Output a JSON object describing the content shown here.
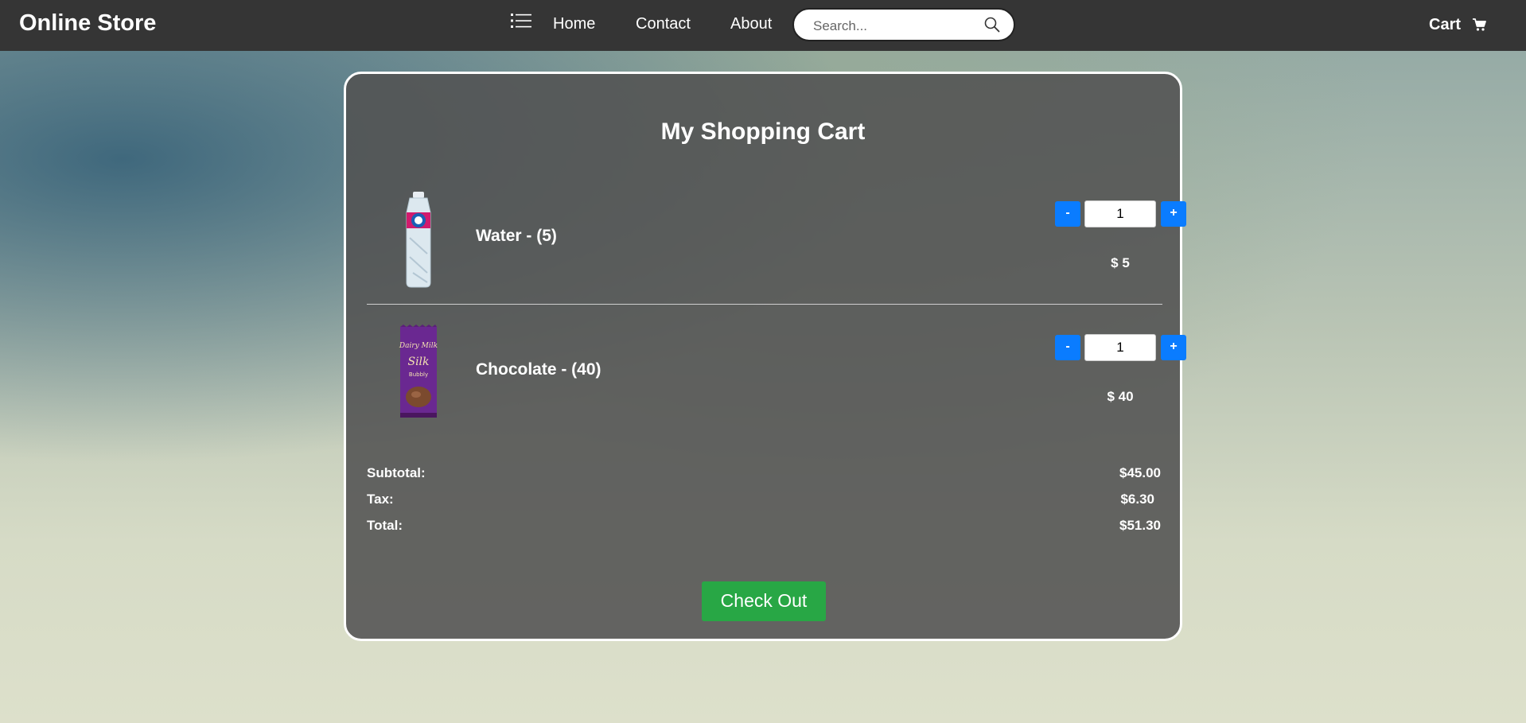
{
  "navbar": {
    "brand": "Online Store",
    "links": [
      "Home",
      "Contact",
      "About"
    ],
    "search_placeholder": "Search...",
    "cart_label": "Cart"
  },
  "cart": {
    "title": "My Shopping Cart",
    "items": [
      {
        "name": "Water - (5)",
        "quantity": "1",
        "price": "$ 5",
        "decrement": "-",
        "increment": "+"
      },
      {
        "name": "Chocolate - (40)",
        "quantity": "1",
        "price": "$ 40",
        "decrement": "-",
        "increment": "+"
      }
    ],
    "summary": {
      "subtotal_label": "Subtotal:",
      "subtotal": "$45.00",
      "tax_label": "Tax:",
      "tax": "$6.30",
      "total_label": "Total:",
      "total": "$51.30"
    },
    "checkout_label": "Check Out"
  },
  "colors": {
    "navbar": "#353535",
    "qty_button": "#0a7cff",
    "checkout": "#28a745"
  },
  "icons": [
    "list-icon",
    "search-icon",
    "shopping-cart-icon"
  ]
}
